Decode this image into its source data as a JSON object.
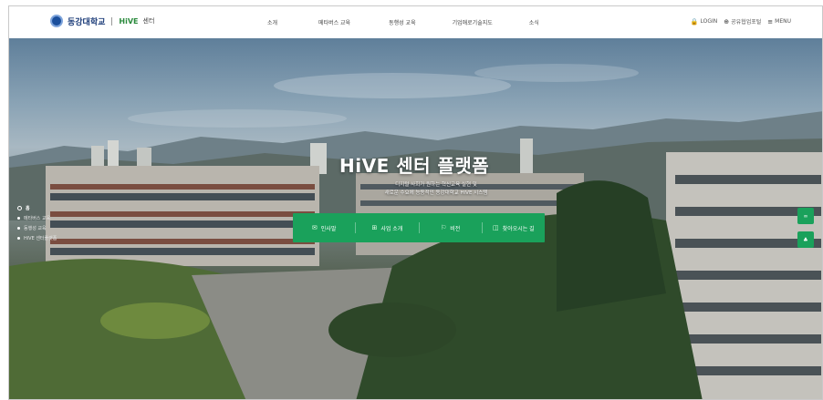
{
  "header": {
    "logo_univ": "동강대학교",
    "logo_hive": "HiVE",
    "logo_center": "센터",
    "nav": [
      "소개",
      "메타버스 교육",
      "동행성 교육",
      "기업애로기술지도",
      "소식"
    ],
    "util": [
      {
        "icon": "lock-icon",
        "glyph": "🔒",
        "label": "LOGIN"
      },
      {
        "icon": "globe-icon",
        "glyph": "⊕",
        "label": "공유협업포털"
      },
      {
        "icon": "menu-icon",
        "glyph": "≡",
        "label": "MENU"
      }
    ]
  },
  "hero": {
    "title": "HiVE 센터 플랫폼",
    "subtitle_line1": "디지털 사회가 원하는 혁신교육 실현 및",
    "subtitle_line2": "새로운 수요에 능동적인 동강대학교 HiVE 시스템",
    "buttons": [
      {
        "icon": "mail-icon",
        "glyph": "✉",
        "label": "인사말"
      },
      {
        "icon": "sitemap-icon",
        "glyph": "⊞",
        "label": "사업 소개"
      },
      {
        "icon": "flag-icon",
        "glyph": "⚐",
        "label": "비전"
      },
      {
        "icon": "map-icon",
        "glyph": "◫",
        "label": "찾아오시는 길"
      }
    ],
    "side_nav": [
      "홈",
      "메타버스 교육",
      "동행성 교육",
      "HiVE 센터플랫폼"
    ],
    "quick": [
      "∞",
      "♣"
    ]
  },
  "colors": {
    "accent": "#1aa15b",
    "brand": "#1b3b78"
  }
}
